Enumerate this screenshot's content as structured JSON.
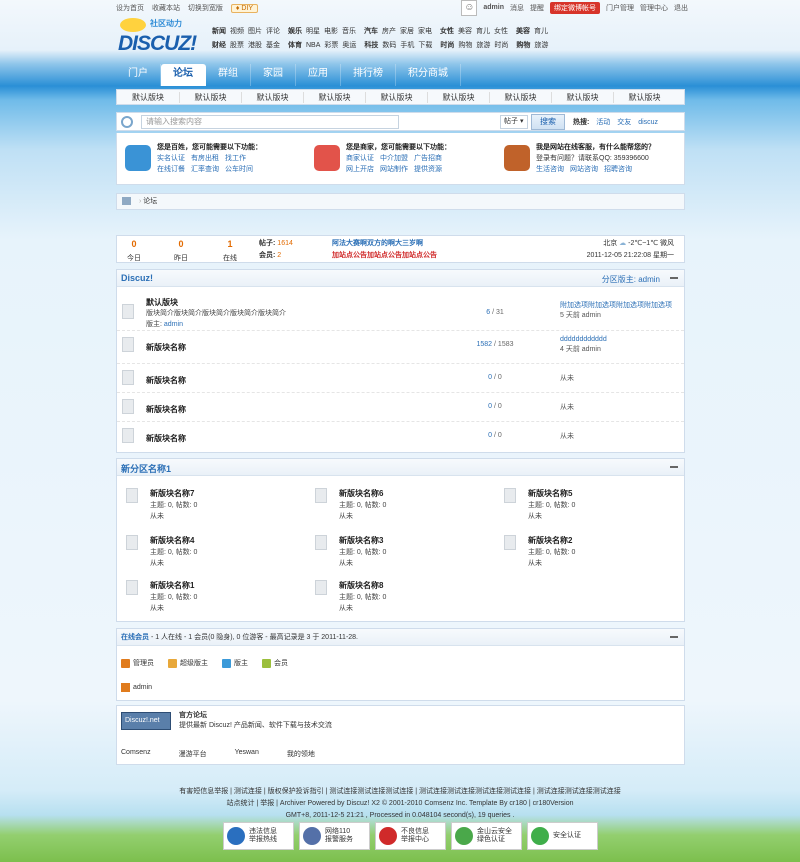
{
  "topbar": {
    "set_home": "设为首页",
    "bookmark": "收藏本站",
    "switch_style": "切换到宽版",
    "diy": "♦ DIY",
    "user": "admin",
    "messages": "消息",
    "reminders": "提醒",
    "bind_weibo": "绑定微博帐号",
    "portal_admin": "门户管理",
    "admin_center": "管理中心",
    "logout": "退出"
  },
  "logo": {
    "sub": "社区动力",
    "brand": "DISCUZ!"
  },
  "categories": {
    "row1": [
      "新闻",
      "视频",
      "图片",
      "评论",
      "娱乐",
      "明星",
      "电影",
      "音乐",
      "汽车",
      "房产",
      "家居",
      "家电",
      "女性",
      "美容",
      "育儿",
      "女性",
      "美容",
      "育儿"
    ],
    "row2": [
      "财经",
      "股票",
      "港股",
      "基金",
      "体育",
      "NBA",
      "彩票",
      "奥运",
      "科技",
      "数码",
      "手机",
      "下载",
      "时尚",
      "购物",
      "旅游",
      "时尚",
      "购物",
      "旅游"
    ]
  },
  "nav": [
    "门户",
    "论坛",
    "群组",
    "家园",
    "应用",
    "排行榜",
    "积分商城"
  ],
  "subnav": [
    "默认版块",
    "默认版块",
    "默认版块",
    "默认版块",
    "默认版块",
    "默认版块",
    "默认版块",
    "默认版块",
    "默认版块"
  ],
  "search": {
    "placeholder": "请输入搜索内容",
    "type": "帖子",
    "button": "搜索",
    "hot_label": "热搜:",
    "hot": [
      "活动",
      "交友",
      "discuz"
    ]
  },
  "promo": [
    {
      "title": "您是百姓，您可能需要以下功能：",
      "links": [
        "实名认证",
        "有房出租",
        "找工作",
        "在线订餐",
        "汇率查询",
        "公车时间"
      ],
      "color": "#3a93d6"
    },
    {
      "title": "您是商家，您可能需要以下功能：",
      "links": [
        "商家认证",
        "中介加盟",
        "广告招商",
        "网上开店",
        "网站制作",
        "提供资源"
      ],
      "color": "#e2534a"
    },
    {
      "title": "我是网站在线客服，有什么能帮您的？",
      "links": [
        "登录有问题？请联系QQ: 359396600",
        "生活咨询",
        "网站咨询",
        "招聘咨询"
      ],
      "color": "#c0622a"
    }
  ],
  "breadcrumb": {
    "current": "论坛"
  },
  "stats": {
    "today": {
      "value": "0",
      "label": "今日"
    },
    "yesterday": {
      "value": "0",
      "label": "昨日"
    },
    "online": {
      "value": "1",
      "label": "在线"
    },
    "posts_label": "帖子:",
    "posts": "1614",
    "members_label": "会员:",
    "members": "2",
    "announce1": "阿法大赛啊双方的啊大三岁啊",
    "announce2": "加站点公告加站点公告加站点公告",
    "city": "北京",
    "weather": "-2℃~1℃ 微风",
    "datetime": "2011-12-05 21:22:08 星期一"
  },
  "forum1": {
    "title": "Discuz!",
    "moderator": "分区版主: admin",
    "rows": [
      {
        "name": "默认版块",
        "desc": "版块简介版块简介版块简介版块简介版块简介",
        "mod_label": "版主:",
        "mod": "admin",
        "threads": "6",
        "posts": "31",
        "last_title": "附加选项附加选项附加选项附加选项",
        "last_meta": "5 天前 admin"
      },
      {
        "name": "新版块名称",
        "threads": "1582",
        "posts": "1583",
        "last_title": "dddddddddddd",
        "last_meta": "4 天前 admin"
      },
      {
        "name": "新版块名称",
        "threads": "0",
        "posts": "0",
        "last_meta": "从未"
      },
      {
        "name": "新版块名称",
        "threads": "0",
        "posts": "0",
        "last_meta": "从未"
      },
      {
        "name": "新版块名称",
        "threads": "0",
        "posts": "0",
        "last_meta": "从未"
      }
    ]
  },
  "forum2": {
    "title": "新分区名称1",
    "cells": [
      {
        "name": "新版块名称7",
        "l1": "主题: 0, 帖数: 0",
        "l2": "从未"
      },
      {
        "name": "新版块名称6",
        "l1": "主题: 0, 帖数: 0",
        "l2": "从未"
      },
      {
        "name": "新版块名称5",
        "l1": "主题: 0, 帖数: 0",
        "l2": "从未"
      },
      {
        "name": "新版块名称4",
        "l1": "主题: 0, 帖数: 0",
        "l2": "从未"
      },
      {
        "name": "新版块名称3",
        "l1": "主题: 0, 帖数: 0",
        "l2": "从未"
      },
      {
        "name": "新版块名称2",
        "l1": "主题: 0, 帖数: 0",
        "l2": "从未"
      },
      {
        "name": "新版块名称1",
        "l1": "主题: 0, 帖数: 0",
        "l2": "从未"
      },
      {
        "name": "新版块名称8",
        "l1": "主题: 0, 帖数: 0",
        "l2": "从未"
      }
    ]
  },
  "online": {
    "label": "在线会员",
    "summary": " - 1 人在线 - 1 会员(0 隐身), 0 位游客 - 最高记录是 3 于 2011-11-28.",
    "legend": [
      {
        "label": "管理员",
        "color": "#e07b1d"
      },
      {
        "label": "超级版主",
        "color": "#e8a83a"
      },
      {
        "label": "版主",
        "color": "#3b9ad9"
      },
      {
        "label": "会员",
        "color": "#9bbf3c"
      }
    ],
    "user": "admin"
  },
  "links": {
    "badge": "Discuz!.net",
    "title": "官方论坛",
    "desc": "提供最新 Discuz! 产品新闻、软件下载与技术交流",
    "items": [
      "Comsenz",
      "漫游平台",
      "Yeswan",
      "我的领地"
    ]
  },
  "footer": {
    "line1": "有害短信息举报 | 测试连接 | 版权保护投诉指引 | 测试连接测试连接测试连接 | 测试连接测试连接测试连接测试连接 | 测试连接测试连接测试连接",
    "line2": "站点统计 | 举报 | Archiver Powered by Discuz! X2 © 2001-2010 Comsenz Inc. Template By cr180 | cr180Version",
    "line3": "GMT+8, 2011-12-5 21:21 , Processed in 0.048104 second(s), 19 queries ."
  },
  "badges": [
    {
      "l1": "违法信息",
      "l2": "举报热线",
      "color": "#2a6fbf"
    },
    {
      "l1": "网络110",
      "l2": "报警服务",
      "color": "#5470a8"
    },
    {
      "l1": "不良信息",
      "l2": "举报中心",
      "color": "#d02a2a"
    },
    {
      "l1": "金山云安全",
      "l2": "绿色认证",
      "color": "#4aa84a"
    },
    {
      "l1": "安全认证",
      "l2": "",
      "color": "#3fae4a"
    }
  ]
}
